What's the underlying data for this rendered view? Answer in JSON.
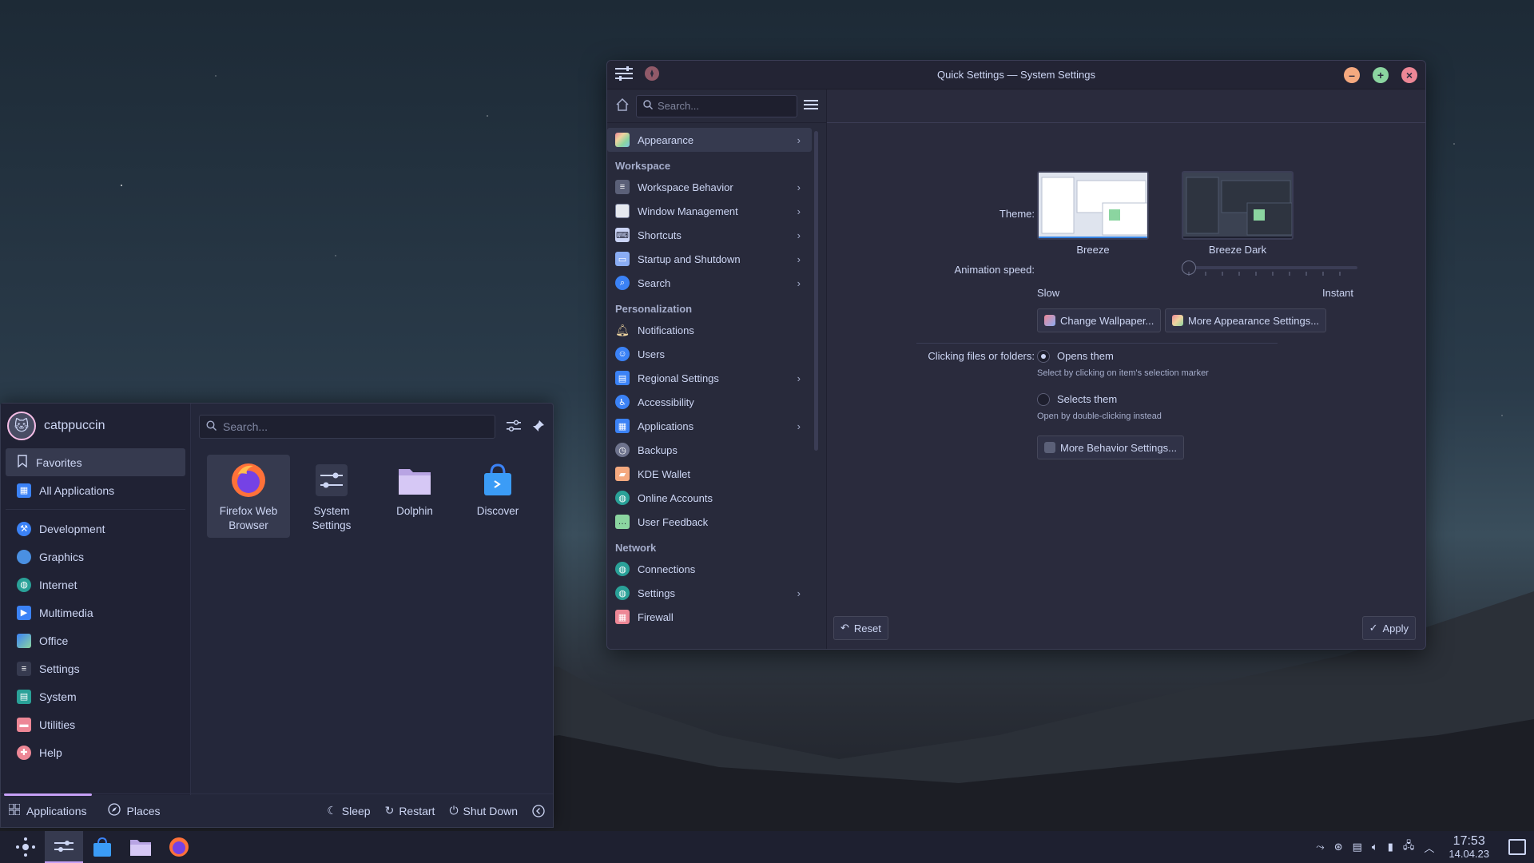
{
  "window": {
    "title": "Quick Settings — System Settings",
    "search_placeholder": "Search...",
    "page_title": "Quick Settings",
    "sidebar": {
      "top_item": "Appearance",
      "sections": [
        {
          "title": "Workspace",
          "items": [
            {
              "label": "Workspace Behavior",
              "chevron": true
            },
            {
              "label": "Window Management",
              "chevron": true
            },
            {
              "label": "Shortcuts",
              "chevron": true
            },
            {
              "label": "Startup and Shutdown",
              "chevron": true
            },
            {
              "label": "Search",
              "chevron": true
            }
          ]
        },
        {
          "title": "Personalization",
          "items": [
            {
              "label": "Notifications",
              "chevron": false
            },
            {
              "label": "Users",
              "chevron": false
            },
            {
              "label": "Regional Settings",
              "chevron": true
            },
            {
              "label": "Accessibility",
              "chevron": false
            },
            {
              "label": "Applications",
              "chevron": true
            },
            {
              "label": "Backups",
              "chevron": false
            },
            {
              "label": "KDE Wallet",
              "chevron": false
            },
            {
              "label": "Online Accounts",
              "chevron": false
            },
            {
              "label": "User Feedback",
              "chevron": false
            }
          ]
        },
        {
          "title": "Network",
          "items": [
            {
              "label": "Connections",
              "chevron": false
            },
            {
              "label": "Settings",
              "chevron": true
            },
            {
              "label": "Firewall",
              "chevron": false
            }
          ]
        }
      ]
    },
    "content": {
      "theme_label": "Theme:",
      "theme_light": "Breeze",
      "theme_dark": "Breeze Dark",
      "animation_label": "Animation speed:",
      "slow": "Slow",
      "instant": "Instant",
      "animation_speed": 0,
      "change_wallpaper": "Change Wallpaper...",
      "more_appearance": "More Appearance Settings...",
      "clicking_label": "Clicking files or folders:",
      "opens_them": "Opens them",
      "opens_hint": "Select by clicking on item's selection marker",
      "selects_them": "Selects them",
      "selects_hint": "Open by double-clicking instead",
      "more_behavior": "More Behavior Settings...",
      "reset": "Reset",
      "apply": "Apply"
    }
  },
  "launcher": {
    "username": "catppuccin",
    "search_placeholder": "Search...",
    "categories": [
      "Favorites",
      "All Applications",
      "Development",
      "Graphics",
      "Internet",
      "Multimedia",
      "Office",
      "Settings",
      "System",
      "Utilities",
      "Help"
    ],
    "apps": [
      {
        "line1": "Firefox Web",
        "line2": "Browser"
      },
      {
        "line1": "System",
        "line2": "Settings"
      },
      {
        "line1": "Dolphin",
        "line2": ""
      },
      {
        "line1": "Discover",
        "line2": ""
      }
    ],
    "bottom": {
      "applications": "Applications",
      "places": "Places",
      "sleep": "Sleep",
      "restart": "Restart",
      "shutdown": "Shut Down"
    }
  },
  "panel": {
    "time": "17:53",
    "date": "14.04.23"
  },
  "colors": {
    "accent": "#c6a0f6",
    "base": "#24273a",
    "text": "#cdd6f4"
  }
}
